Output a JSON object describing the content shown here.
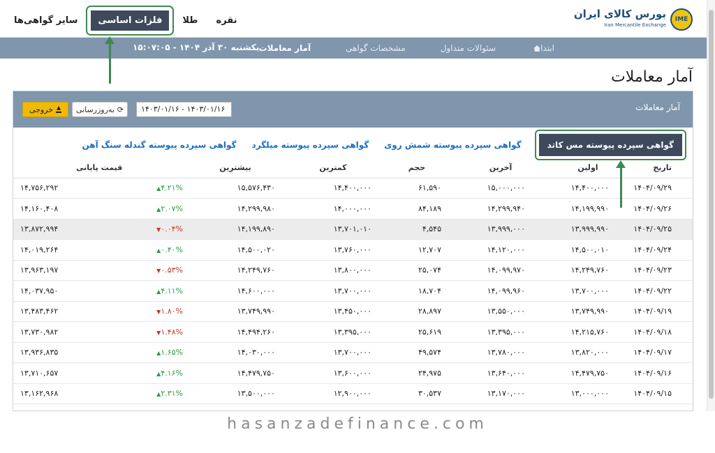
{
  "header": {
    "logo_fa": "بورس کالای ایران",
    "logo_en": "Iran Mercantile Exchange",
    "logo_mark": "IME",
    "tabs": [
      {
        "label": "سایر گواهی‌ها"
      },
      {
        "label": "فلزات اساسی",
        "active": true
      },
      {
        "label": "طلا"
      },
      {
        "label": "نقره"
      }
    ]
  },
  "subnav": {
    "items": [
      {
        "label": "ابتدا"
      },
      {
        "label": "سئوالات متداول"
      },
      {
        "label": "مشخصات گواهی"
      },
      {
        "label": "آمار معاملات",
        "active": true
      }
    ],
    "datetime": "یکشنبه ۳۰ آذر ۱۴۰۴ - ۱۵:۰۷:۰۵"
  },
  "page_title": "آمار معاملات",
  "card": {
    "title": "آمار معاملات",
    "date_range": "۱۴۰۳/۰۱/۱۶ - ۱۴۰۳/۰۱/۱۶",
    "refresh_label": "به‌روزرسانی",
    "export_label": "خروجی"
  },
  "cert_tabs": [
    {
      "label": "گواهی سپرده پیوسته مس کاتد",
      "active": true
    },
    {
      "label": "گواهی سپرده پیوسته شمش روی"
    },
    {
      "label": "گواهی سپرده پیوسته میلگرد"
    },
    {
      "label": "گواهی سپرده پیوسته گندله سنگ آهن"
    }
  ],
  "table": {
    "headers": {
      "date": "تاریخ",
      "first": "اولین",
      "last": "آخرین",
      "volume": "حجم",
      "min": "کمترین",
      "max": "بیشترین",
      "close": "قیمت پایانی"
    },
    "rows": [
      {
        "date": "۱۴۰۴/۰۹/۲۹",
        "first": "۱۴,۴۰۰,۰۰۰",
        "last": "۱۵,۰۰۰,۰۰۰",
        "volume": "۶۱,۵۹۰",
        "min": "۱۴,۴۰۰,۰۰۰",
        "max": "۱۵,۵۷۶,۴۳۰",
        "change": "۴.۲۱%",
        "dir": "up",
        "close": "۱۴,۷۵۶,۲۹۲"
      },
      {
        "date": "۱۴۰۴/۰۹/۲۶",
        "first": "۱۴,۱۹۹,۹۹۰",
        "last": "۱۴,۲۹۹,۹۴۰",
        "volume": "۸۴,۱۸۹",
        "min": "۱۴,۰۰۰,۰۰۰",
        "max": "۱۴,۲۹۹,۹۸۰",
        "change": "۲.۰۷%",
        "dir": "up",
        "close": "۱۴,۱۶۰,۴۰۸"
      },
      {
        "date": "۱۴۰۴/۰۹/۲۵",
        "first": "۱۳,۹۹۹,۹۹۰",
        "last": "۱۳,۹۹۹,۰۰۰",
        "volume": "۴,۵۴۵",
        "min": "۱۳,۷۰۱,۰۱۰",
        "max": "۱۴,۱۹۹,۸۹۰",
        "change": "۰.۰۴%",
        "dir": "down",
        "close": "۱۳,۸۷۲,۹۹۴",
        "highlight": true
      },
      {
        "date": "۱۴۰۴/۰۹/۲۴",
        "first": "۱۴,۵۰۰,۰۱۰",
        "last": "۱۴,۱۲۰,۰۰۰",
        "volume": "۱۲,۷۰۷",
        "min": "۱۳,۷۶۰,۰۰۰",
        "max": "۱۴,۵۰۰,۰۲۰",
        "change": "۰.۴۰%",
        "dir": "up",
        "close": "۱۴,۰۱۹,۲۶۴"
      },
      {
        "date": "۱۴۰۴/۰۹/۲۳",
        "first": "۱۴,۲۴۹,۷۶۰",
        "last": "۱۴,۰۹۹,۹۷۰",
        "volume": "۲۵,۰۷۴",
        "min": "۱۳,۸۰۰,۰۰۰",
        "max": "۱۴,۲۴۹,۷۶۰",
        "change": "۰.۵۳%",
        "dir": "down",
        "close": "۱۳,۹۶۳,۱۹۷"
      },
      {
        "date": "۱۴۰۴/۰۹/۲۲",
        "first": "۱۳,۷۰۰,۰۰۰",
        "last": "۱۴,۰۹۹,۹۶۰",
        "volume": "۱۸,۷۰۴",
        "min": "۱۳,۷۰۰,۰۰۰",
        "max": "۱۴,۶۰۰,۰۰۰",
        "change": "۴.۱۱%",
        "dir": "up",
        "close": "۱۴,۰۳۷,۹۵۰"
      },
      {
        "date": "۱۴۰۴/۰۹/۱۹",
        "first": "۱۳,۷۴۹,۹۹۰",
        "last": "۱۳,۵۵۰,۰۰۰",
        "volume": "۲۸,۸۹۷",
        "min": "۱۳,۴۵۰,۰۰۰",
        "max": "۱۳,۷۴۹,۹۹۰",
        "change": "۱.۸۰%",
        "dir": "down",
        "close": "۱۳,۴۸۳,۴۶۲"
      },
      {
        "date": "۱۴۰۴/۰۹/۱۸",
        "first": "۱۴,۲۱۵,۷۶۰",
        "last": "۱۳,۳۹۵,۰۰۰",
        "volume": "۲۵,۶۱۹",
        "min": "۱۳,۳۹۵,۰۰۰",
        "max": "۱۴,۴۹۴,۲۶۰",
        "change": "۱.۴۸%",
        "dir": "down",
        "close": "۱۳,۷۳۰,۹۸۲"
      },
      {
        "date": "۱۴۰۴/۰۹/۱۷",
        "first": "۱۳,۸۲۰,۰۰۰",
        "last": "۱۳,۷۸۰,۰۰۰",
        "volume": "۴۹,۵۷۴",
        "min": "۱۳,۷۰۰,۰۰۰",
        "max": "۱۴,۰۳۰,۰۰۰",
        "change": "۱.۶۵%",
        "dir": "up",
        "close": "۱۳,۹۳۶,۸۳۵"
      },
      {
        "date": "۱۴۰۴/۰۹/۱۶",
        "first": "۱۴,۴۷۹,۷۵۰",
        "last": "۱۳,۶۴۰,۰۰۰",
        "volume": "۲۴,۹۷۵",
        "min": "۱۳,۶۰۰,۰۰۰",
        "max": "۱۴,۴۷۹,۷۵۰",
        "change": "۴.۱۶%",
        "dir": "up",
        "close": "۱۳,۷۱۰,۶۵۷"
      },
      {
        "date": "۱۴۰۴/۰۹/۱۵",
        "first": "۱۳,۰۰۰,۰۰۰",
        "last": "۱۳,۱۷۰,۰۰۰",
        "volume": "۳۰,۵۳۷",
        "min": "۱۲,۹۰۰,۰۰۰",
        "max": "۱۳,۵۰۰,۰۰۰",
        "change": "۲.۳۱%",
        "dir": "up",
        "close": "۱۳,۱۶۲,۹۶۸"
      }
    ]
  },
  "watermark": "hasanzadefinance.com",
  "colors": {
    "nav_bar": "#7f96ad",
    "active_tab": "#3e4a5c",
    "highlight_outline": "#3b8a4f",
    "up": "#2e9b4a",
    "down": "#c0392b",
    "export_button": "#f0b90b",
    "link": "#1a6fc4"
  }
}
